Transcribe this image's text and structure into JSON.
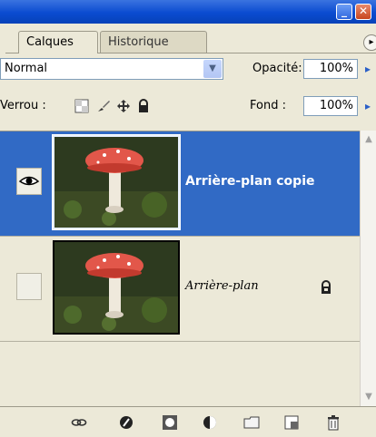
{
  "window": {
    "minimize_label": "_",
    "close_label": "✕"
  },
  "tabs": [
    {
      "label": "Calques",
      "active": true
    },
    {
      "label": "Historique",
      "active": false
    }
  ],
  "panel_menu_label": "▸",
  "blend_mode": {
    "value": "Normal",
    "arrow": "▼"
  },
  "opacity": {
    "label": "Opacité:",
    "value": "100%",
    "arrow": "▸"
  },
  "lock": {
    "label": "Verrou :"
  },
  "fill": {
    "label": "Fond :",
    "value": "100%",
    "arrow": "▸"
  },
  "layers": [
    {
      "name": "Arrière-plan copie",
      "selected": true,
      "visible": true,
      "locked": false
    },
    {
      "name": "Arrière-plan",
      "selected": false,
      "visible": false,
      "locked": true
    }
  ],
  "scroll": {
    "up": "▲",
    "down": "▼"
  },
  "colors": {
    "selection": "#316ac5",
    "panel_bg": "#ece9d8",
    "titlebar": "#0a4bd0"
  },
  "icons": {
    "bottom_toolbar": [
      "link-icon",
      "layer-style-icon",
      "mask-icon",
      "adjustment-layer-icon",
      "folder-icon",
      "new-layer-icon",
      "trash-icon"
    ]
  }
}
